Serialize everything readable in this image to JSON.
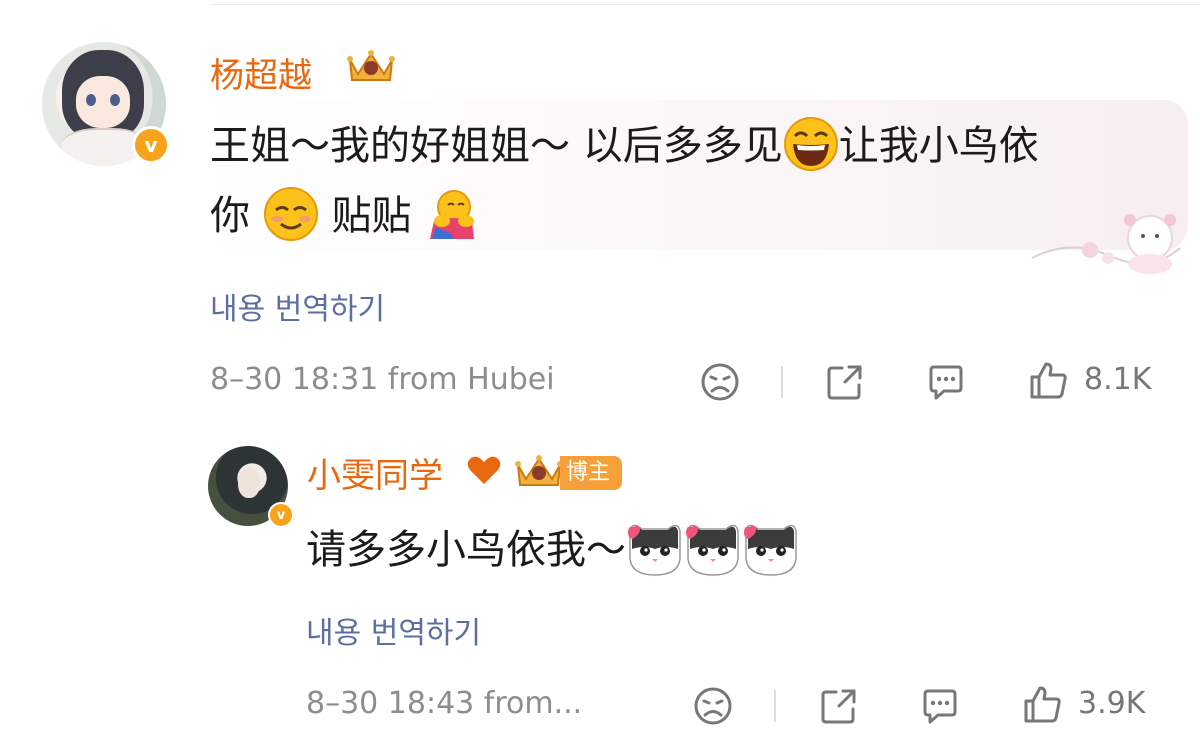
{
  "comments": [
    {
      "username": "杨超越",
      "text_line1": "王姐～我的好姐姐～ 以后多多见",
      "text_line1_tail": "让我小鸟依",
      "text_line2_head": "你",
      "text_line2_tail": "贴贴",
      "translate_label": "내용 번역하기",
      "meta": "8–30 18:31 from Hubei",
      "like_count": "8.1K"
    },
    {
      "username": "小雯同学",
      "badge_label": "博主",
      "text": "请多多小鸟依我～",
      "translate_label": "내용 번역하기",
      "meta": "8–30 18:43 from...",
      "like_count": "3.9K"
    }
  ],
  "colors": {
    "username": "#e8670f",
    "translate_link": "#5d6fa0",
    "meta": "#8d8d8d",
    "verified_badge": "#f7a31c",
    "blogger_badge": "#f7a03a",
    "heart": "#e8670f"
  },
  "icons": [
    "verified-v-icon",
    "crown-icon",
    "heart-icon",
    "grinning-emoji",
    "smiling-emoji",
    "hug-emoji",
    "cat-emoji",
    "dislike-face-icon",
    "share-icon",
    "comment-icon",
    "like-icon"
  ]
}
